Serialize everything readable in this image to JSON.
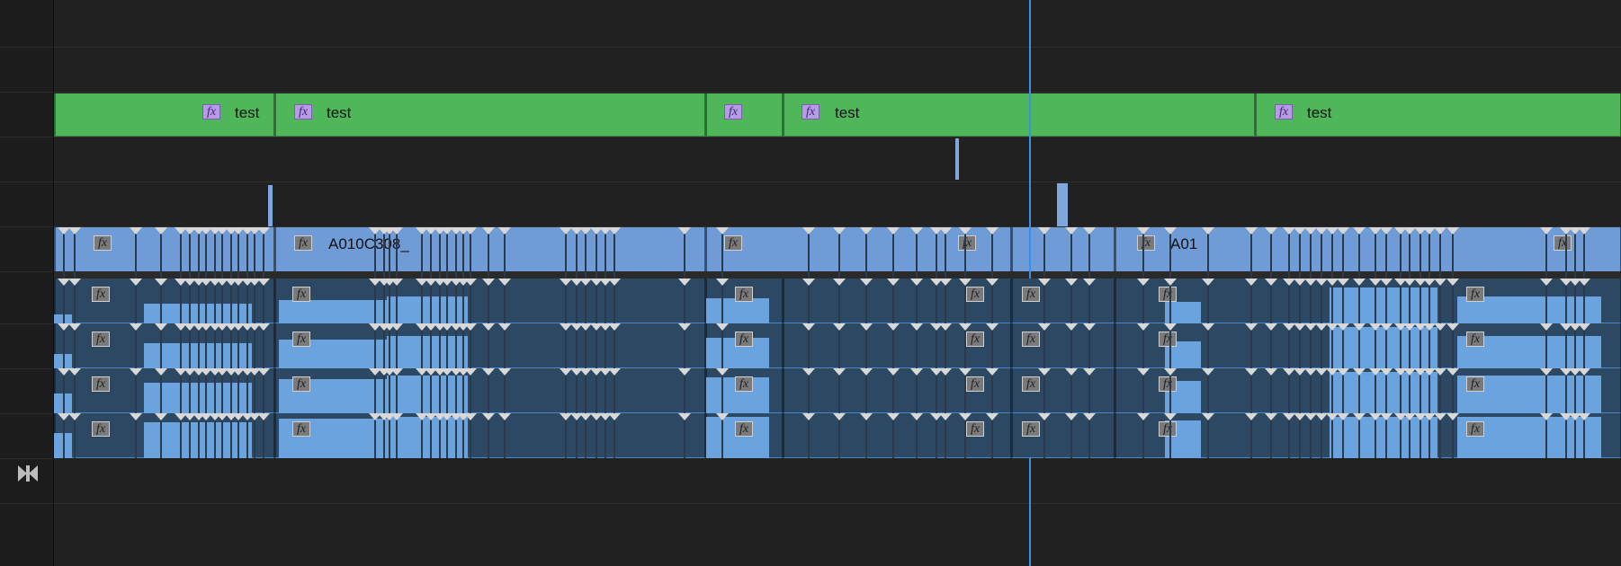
{
  "sidebar": {
    "link_icon": "bowtie-icon"
  },
  "tracks": {
    "titles": {
      "clip_label": "test",
      "fx_label": "fx",
      "clips": [
        {
          "name": "title-clip-1",
          "label": "test"
        },
        {
          "name": "title-clip-2",
          "label": "test"
        },
        {
          "name": "title-clip-3",
          "label": ""
        },
        {
          "name": "title-clip-4",
          "label": "test"
        },
        {
          "name": "title-clip-5",
          "label": "test"
        }
      ]
    },
    "video": {
      "fx_label": "fx",
      "clip_names": [
        "A010C308_",
        "A01"
      ]
    },
    "audio": {
      "fx_label": "fx"
    }
  },
  "colors": {
    "title_clip": "#4fb65a",
    "video_clip": "#6f9bd6",
    "audio_clip": "#2c4863",
    "playhead": "#3a8fe8",
    "fx_title": "#b79ae8"
  }
}
